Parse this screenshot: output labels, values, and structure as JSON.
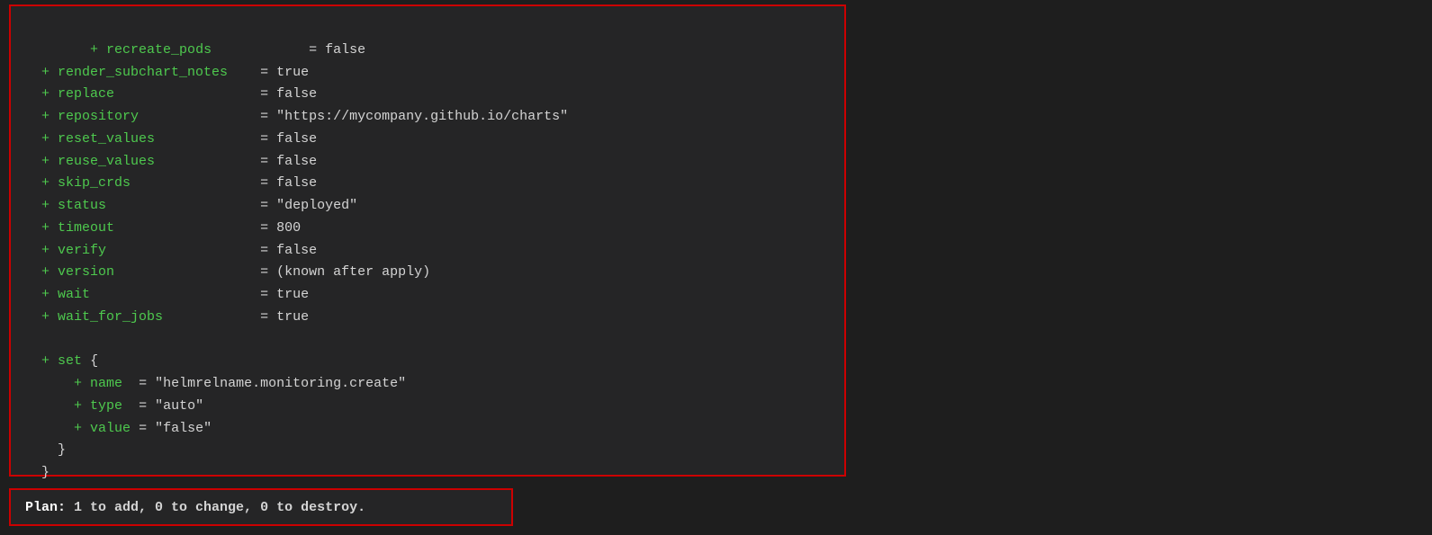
{
  "code": {
    "lines": [
      {
        "plus": "+",
        "key": "recreate_pods",
        "equals": "=",
        "value": "false"
      },
      {
        "plus": "+",
        "key": "render_subchart_notes",
        "equals": "=",
        "value": "true"
      },
      {
        "plus": "+",
        "key": "replace",
        "equals": "=",
        "value": "false"
      },
      {
        "plus": "+",
        "key": "repository",
        "equals": "=",
        "value": "\"https://mycompany.github.io/charts\""
      },
      {
        "plus": "+",
        "key": "reset_values",
        "equals": "=",
        "value": "false"
      },
      {
        "plus": "+",
        "key": "reuse_values",
        "equals": "=",
        "value": "false"
      },
      {
        "plus": "+",
        "key": "skip_crds",
        "equals": "=",
        "value": "false"
      },
      {
        "plus": "+",
        "key": "status",
        "equals": "=",
        "value": "\"deployed\""
      },
      {
        "plus": "+",
        "key": "timeout",
        "equals": "=",
        "value": "800"
      },
      {
        "plus": "+",
        "key": "verify",
        "equals": "=",
        "value": "false"
      },
      {
        "plus": "+",
        "key": "version",
        "equals": "=",
        "value": "(known after apply)"
      },
      {
        "plus": "+",
        "key": "wait",
        "equals": "=",
        "value": "true"
      },
      {
        "plus": "+",
        "key": "wait_for_jobs",
        "equals": "=",
        "value": "true"
      }
    ],
    "set_block": {
      "plus": "+",
      "keyword": "set",
      "open_brace": "{",
      "fields": [
        {
          "plus": "+",
          "key": "name",
          "equals": "=",
          "value": "\"helmrelname.monitoring.create\""
        },
        {
          "plus": "+",
          "key": "type",
          "equals": "=",
          "value": "\"auto\""
        },
        {
          "plus": "+",
          "key": "value",
          "equals": "=",
          "value": "\"false\""
        }
      ],
      "close_brace": "}",
      "outer_brace": "}"
    }
  },
  "plan": {
    "label": "Plan:",
    "text": "1 to add, 0 to change, 0 to destroy."
  }
}
